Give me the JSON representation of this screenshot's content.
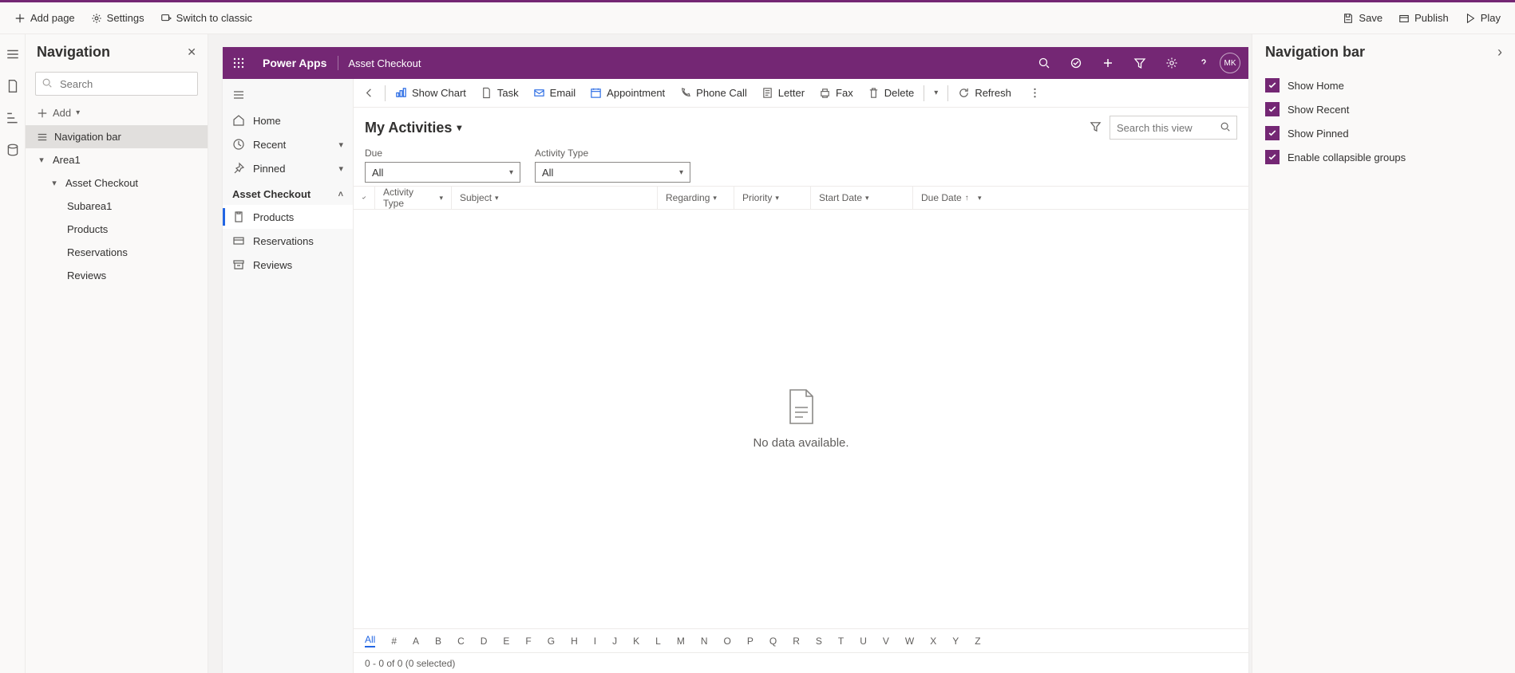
{
  "topbar": {
    "addPage": "Add page",
    "settings": "Settings",
    "switchClassic": "Switch to classic",
    "save": "Save",
    "publish": "Publish",
    "play": "Play"
  },
  "navPanel": {
    "title": "Navigation",
    "searchPlaceholder": "Search",
    "addLabel": "Add",
    "items": {
      "navBar": "Navigation bar",
      "area1": "Area1",
      "assetCheckout": "Asset Checkout",
      "subarea1": "Subarea1",
      "products": "Products",
      "reservations": "Reservations",
      "reviews": "Reviews"
    }
  },
  "appHeader": {
    "brand": "Power Apps",
    "appName": "Asset Checkout",
    "avatar": "MK"
  },
  "appSidebar": {
    "home": "Home",
    "recent": "Recent",
    "pinned": "Pinned",
    "group": "Asset Checkout",
    "products": "Products",
    "reservations": "Reservations",
    "reviews": "Reviews"
  },
  "commandBar": {
    "showChart": "Show Chart",
    "task": "Task",
    "email": "Email",
    "appointment": "Appointment",
    "phoneCall": "Phone Call",
    "letter": "Letter",
    "fax": "Fax",
    "delete": "Delete",
    "refresh": "Refresh"
  },
  "view": {
    "title": "My Activities",
    "searchPlaceholder": "Search this view",
    "dueLabel": "Due",
    "dueValue": "All",
    "activityTypeLabel": "Activity Type",
    "activityTypeValue": "All"
  },
  "gridColumns": {
    "activityType": "Activity Type",
    "subject": "Subject",
    "regarding": "Regarding",
    "priority": "Priority",
    "startDate": "Start Date",
    "dueDate": "Due Date"
  },
  "emptyState": "No data available.",
  "alphaBar": [
    "All",
    "#",
    "A",
    "B",
    "C",
    "D",
    "E",
    "F",
    "G",
    "H",
    "I",
    "J",
    "K",
    "L",
    "M",
    "N",
    "O",
    "P",
    "Q",
    "R",
    "S",
    "T",
    "U",
    "V",
    "W",
    "X",
    "Y",
    "Z"
  ],
  "statusBar": "0 - 0 of 0 (0 selected)",
  "rightPanel": {
    "title": "Navigation bar",
    "showHome": "Show Home",
    "showRecent": "Show Recent",
    "showPinned": "Show Pinned",
    "enableGroups": "Enable collapsible groups"
  }
}
